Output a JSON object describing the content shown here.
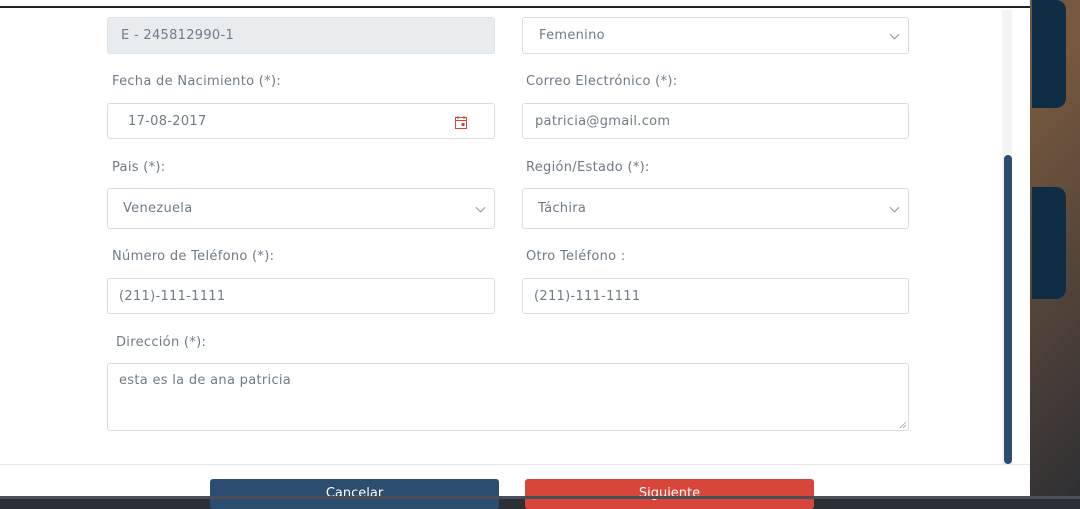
{
  "form": {
    "cedula_value": "E - 245812990-1",
    "genero_value": "Femenino",
    "fecha_label": "Fecha de Nacimiento (*):",
    "fecha_value": "17-08-2017",
    "correo_label": "Correo Electrónico (*):",
    "correo_value": "patricia@gmail.com",
    "pais_label": "Pais (*):",
    "pais_value": "Venezuela",
    "region_label": "Región/Estado (*):",
    "region_value": "Táchira",
    "telefono_label": "Número de Teléfono (*):",
    "telefono_value": "(211)-111-1111",
    "otro_telefono_label": "Otro Teléfono :",
    "otro_telefono_value": "(211)-111-1111",
    "direccion_label": "Dirección (*):",
    "direccion_value": "esta es la de ana patricia"
  },
  "footer": {
    "cancel_label": "Cancelar",
    "next_label": "Siguiente"
  },
  "colors": {
    "primary": "#2c4d70",
    "danger": "#d8453a",
    "calendar_icon": "#d8453a"
  }
}
